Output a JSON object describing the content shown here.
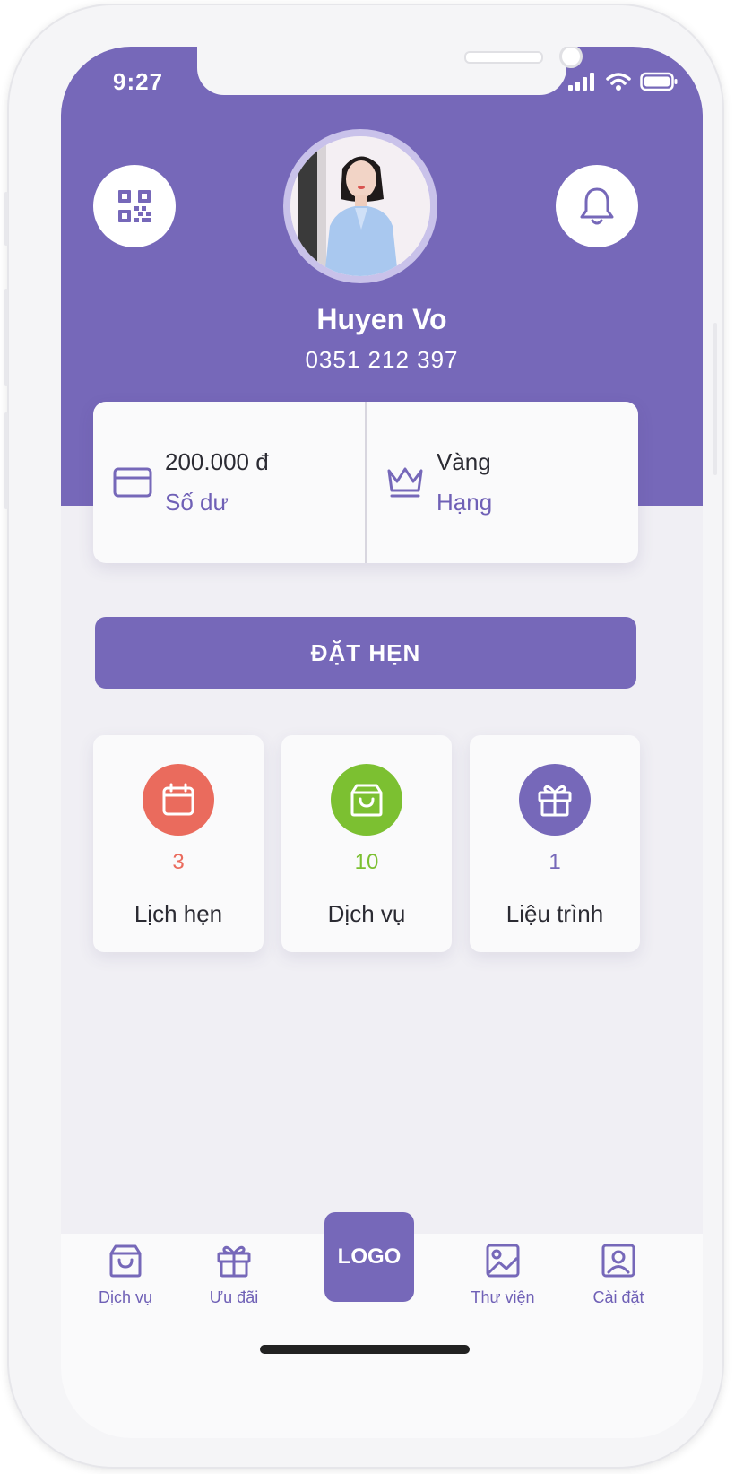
{
  "status_bar": {
    "time": "9:27"
  },
  "profile": {
    "name": "Huyen Vo",
    "phone": "0351 212 397"
  },
  "summary": {
    "balance": {
      "value": "200.000 đ",
      "label": "Số dư"
    },
    "rank": {
      "value": "Vàng",
      "label": "Hạng"
    }
  },
  "book_button": {
    "label": "ĐẶT HẸN"
  },
  "tiles": [
    {
      "count": "3",
      "label": "Lịch hẹn",
      "color": "#ea6b5d",
      "icon": "calendar-icon"
    },
    {
      "count": "10",
      "label": "Dịch vụ",
      "color": "#7cc031",
      "icon": "bag-icon"
    },
    {
      "count": "1",
      "label": "Liệu trình",
      "color": "#7668b9",
      "icon": "gift-icon"
    }
  ],
  "bottom_nav": {
    "items": [
      {
        "label": "Dịch vụ",
        "icon": "bag-icon"
      },
      {
        "label": "Ưu đãi",
        "icon": "gift-icon"
      },
      {
        "label": "Thư viện",
        "icon": "image-icon"
      },
      {
        "label": "Cài đặt",
        "icon": "user-card-icon"
      }
    ],
    "logo": "LOGO"
  },
  "colors": {
    "primary": "#7668b9",
    "background": "#f0eff4",
    "red": "#ea6b5d",
    "green": "#7cc031"
  }
}
